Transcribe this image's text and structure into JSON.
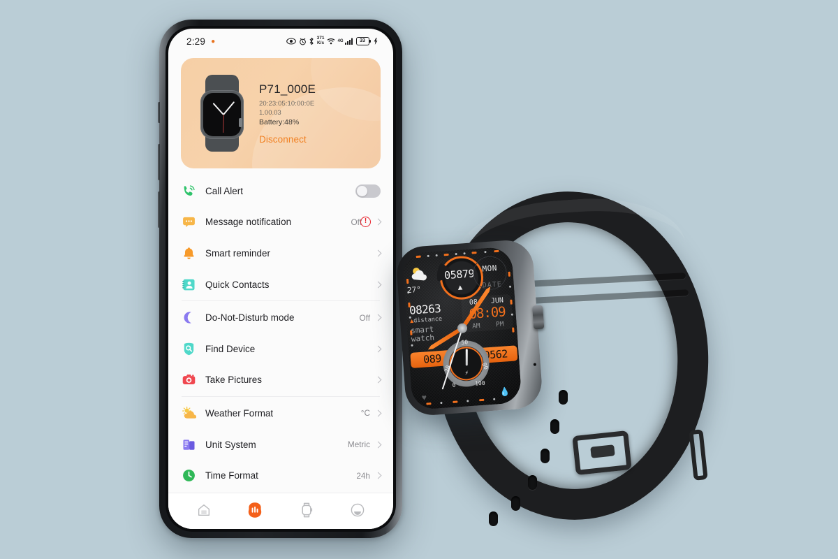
{
  "background_color": "#bacdd6",
  "phone": {
    "status_bar": {
      "time": "2:29",
      "location_icon": "location-pin-icon",
      "icons": [
        "eye-icon",
        "alarm-clock-icon",
        "bluetooth-icon"
      ],
      "network_speed": "371",
      "network_speed_unit": "K/s",
      "wifi_icon": "wifi-icon",
      "network_type": "4G",
      "signal_icon": "cellular-signal-icon",
      "battery_percent": "33",
      "charging_icon": "charging-bolt-icon"
    },
    "device_card": {
      "accent_color": "#f18022",
      "background_color": "#f6cfa6",
      "thumbnail": "smartwatch-thumbnail",
      "name": "P71_000E",
      "mac": "20:23:05:10:00:0E",
      "firmware": "1.00.03",
      "battery": "Battery:48%",
      "disconnect_label": "Disconnect"
    },
    "settings": [
      {
        "icon": "phone-call-icon",
        "label": "Call Alert",
        "value": "",
        "control": "toggle",
        "toggle_on": false,
        "warn": false,
        "chevron": false
      },
      {
        "icon": "message-bubble-icon",
        "label": "Message notification",
        "value": "Off",
        "control": "chevron",
        "toggle_on": false,
        "warn": true,
        "chevron": true
      },
      {
        "icon": "bell-icon",
        "label": "Smart reminder",
        "value": "",
        "control": "chevron",
        "toggle_on": false,
        "warn": false,
        "chevron": true
      },
      {
        "icon": "contact-card-icon",
        "label": "Quick Contacts",
        "value": "",
        "control": "chevron",
        "toggle_on": false,
        "warn": false,
        "chevron": true
      },
      {
        "icon": "moon-icon",
        "label": "Do-Not-Disturb mode",
        "value": "Off",
        "control": "chevron",
        "toggle_on": false,
        "warn": false,
        "chevron": true
      },
      {
        "icon": "find-device-icon",
        "label": "Find Device",
        "value": "",
        "control": "chevron",
        "toggle_on": false,
        "warn": false,
        "chevron": true
      },
      {
        "icon": "camera-icon",
        "label": "Take Pictures",
        "value": "",
        "control": "chevron",
        "toggle_on": false,
        "warn": false,
        "chevron": true
      },
      {
        "icon": "sun-cloud-icon",
        "label": "Weather Format",
        "value": "°C",
        "control": "chevron",
        "toggle_on": false,
        "warn": false,
        "chevron": true
      },
      {
        "icon": "unit-system-icon",
        "label": "Unit System",
        "value": "Metric",
        "control": "chevron",
        "toggle_on": false,
        "warn": false,
        "chevron": true
      },
      {
        "icon": "clock-icon",
        "label": "Time Format",
        "value": "24h",
        "control": "chevron",
        "toggle_on": false,
        "warn": false,
        "chevron": true
      }
    ],
    "divider_after_indices": [
      3,
      6
    ],
    "bottom_nav": [
      {
        "icon": "home-icon",
        "active": false
      },
      {
        "icon": "health-stats-icon",
        "active": true
      },
      {
        "icon": "watch-icon",
        "active": false
      },
      {
        "icon": "profile-icon",
        "active": false
      }
    ],
    "bottom_nav_active_color": "#f4601a"
  },
  "watch": {
    "accent_color": "#f2701d",
    "face": {
      "weather_icon": "sun-cloud-icon",
      "temperature": "27°",
      "steps": "05879",
      "steps_icon": "mountain-icon",
      "weekday": "MON",
      "date_label": "DATE",
      "distance_value": "08263",
      "distance_label": "distance",
      "brand_line1": "smart",
      "brand_line2": "watch",
      "date_day": "08",
      "date_month": "JUN",
      "time": "08:09",
      "am_label": "AM",
      "pm_label": "PM",
      "heart_rate": "089",
      "calories": "0562",
      "gauge_ticks": [
        "0",
        "20",
        "50",
        "80",
        "100"
      ],
      "gauge_icon": "lightning-bolt-icon",
      "left_bottom_icon": "heart-icon",
      "right_bottom_icon": "flame-icon"
    }
  }
}
